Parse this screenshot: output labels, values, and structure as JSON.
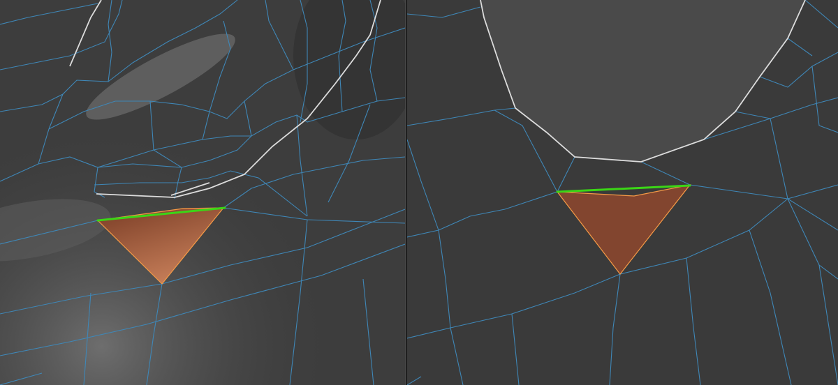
{
  "viewports": [
    {
      "id": "left",
      "view": "perspective",
      "shading": "smooth",
      "selection": {
        "mode": "face",
        "selected_faces": 1,
        "highlighted_edges": 1
      }
    },
    {
      "id": "right",
      "view": "orthographic",
      "shading": "flat",
      "selection": {
        "mode": "face",
        "selected_faces": 1,
        "highlighted_edges": 1
      }
    }
  ],
  "colors": {
    "background": "#3a3a3a",
    "wireframe": "#3f87b7",
    "silhouette_edge": "#dcdcdc",
    "selected_face_fill": "#8a4a2e",
    "selected_face_outline": "#f59a46",
    "selected_edge": "#3bd616",
    "divider": "#1f1f1f"
  }
}
